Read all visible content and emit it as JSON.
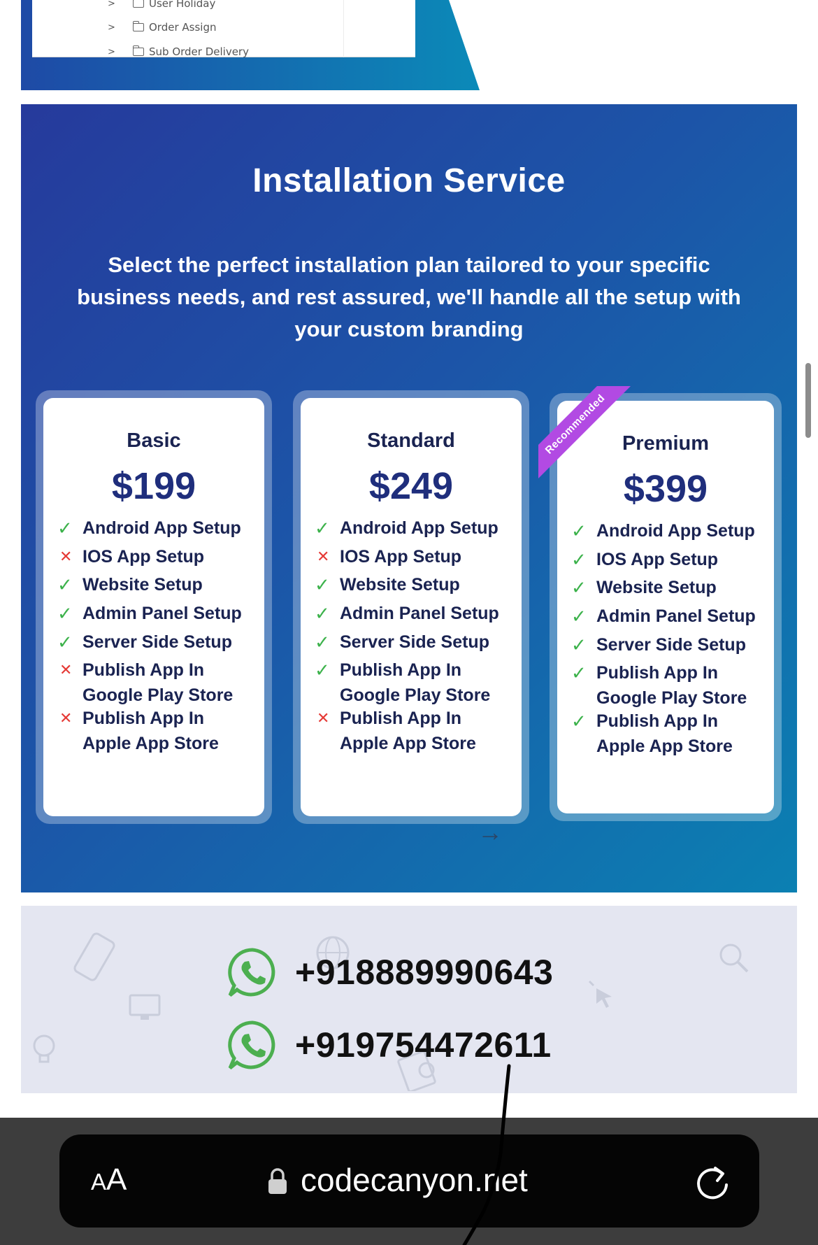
{
  "tree_menu": {
    "items": [
      {
        "label": "User Holiday"
      },
      {
        "label": "Order Assign"
      },
      {
        "label": "Sub Order Delivery"
      }
    ]
  },
  "installation": {
    "title": "Installation Service",
    "subtitle": "Select the perfect installation plan tailored to your specific business needs, and rest assured, we'll handle all the setup with your custom branding",
    "plans": [
      {
        "name": "Basic",
        "price": "$199",
        "features": [
          {
            "label": "Android App Setup",
            "included": true
          },
          {
            "label": "IOS App Setup",
            "included": false
          },
          {
            "label": "Website Setup",
            "included": true
          },
          {
            "label": "Admin Panel Setup",
            "included": true
          },
          {
            "label": "Server Side Setup",
            "included": true
          },
          {
            "label": "Publish App In\nGoogle Play Store",
            "included": false
          },
          {
            "label": "Publish App In\nApple App Store",
            "included": false
          }
        ]
      },
      {
        "name": "Standard",
        "price": "$249",
        "features": [
          {
            "label": "Android App Setup",
            "included": true
          },
          {
            "label": "IOS App Setup",
            "included": false
          },
          {
            "label": "Website Setup",
            "included": true
          },
          {
            "label": "Admin Panel Setup",
            "included": true
          },
          {
            "label": "Server Side Setup",
            "included": true
          },
          {
            "label": "Publish App In\nGoogle Play Store",
            "included": true
          },
          {
            "label": "Publish App In\nApple App Store",
            "included": false
          }
        ]
      },
      {
        "name": "Premium",
        "price": "$399",
        "ribbon": "Recommended",
        "features": [
          {
            "label": "Android App Setup",
            "included": true
          },
          {
            "label": "IOS App Setup",
            "included": true
          },
          {
            "label": "Website Setup",
            "included": true
          },
          {
            "label": "Admin Panel Setup",
            "included": true
          },
          {
            "label": "Server Side Setup",
            "included": true
          },
          {
            "label": "Publish App In\nGoogle Play Store",
            "included": true
          },
          {
            "label": "Publish App In\nApple App Store",
            "included": true
          }
        ]
      }
    ],
    "marks": {
      "yes": "✓",
      "no": "✕"
    }
  },
  "contact": {
    "phones": [
      "+918889990643",
      "+919754472611"
    ],
    "icon": "whatsapp-icon"
  },
  "browser": {
    "aa_label_small": "A",
    "aa_label_large": "A",
    "url": "codecanyon.net"
  },
  "colors": {
    "section_gradient_start": "#263a9c",
    "section_gradient_end": "#0b80b2",
    "check_green": "#3cb24b",
    "cross_red": "#e53935",
    "ribbon_purple": "#b24ae3",
    "whatsapp_green": "#4caf50"
  }
}
